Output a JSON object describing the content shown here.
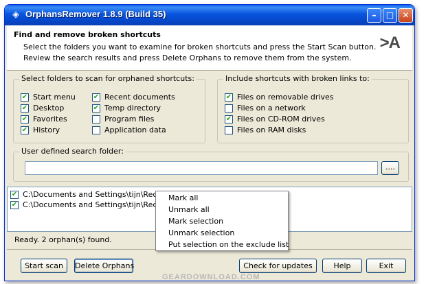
{
  "window": {
    "title": "OrphansRemover 1.8.9 (Build 35)",
    "controls": {
      "minimize": "–",
      "maximize": "□",
      "close": "✕"
    }
  },
  "header": {
    "title": "Find and remove broken shortcuts",
    "line1": "Select the folders you want to examine for broken shortcuts and press the Start Scan button.",
    "line2": "Review the search results and press Delete Orphans to remove them from the system.",
    "logo": ">A"
  },
  "folders_group": {
    "label": "Select folders to scan for orphaned shortcuts:",
    "items": [
      {
        "label": "Start menu",
        "checked": true
      },
      {
        "label": "Desktop",
        "checked": true
      },
      {
        "label": "Favorites",
        "checked": true
      },
      {
        "label": "History",
        "checked": true
      },
      {
        "label": "Recent documents",
        "checked": true
      },
      {
        "label": "Temp directory",
        "checked": true
      },
      {
        "label": "Program files",
        "checked": false
      },
      {
        "label": "Application data",
        "checked": false
      }
    ]
  },
  "links_group": {
    "label": "Include shortcuts with broken links to:",
    "items": [
      {
        "label": "Files on removable drives",
        "checked": true
      },
      {
        "label": "Files on a network",
        "checked": false
      },
      {
        "label": "Files on CD-ROM drives",
        "checked": true
      },
      {
        "label": "Files on RAM disks",
        "checked": false
      }
    ]
  },
  "search_folder": {
    "label": "User defined search folder:",
    "value": "",
    "browse_label": "...."
  },
  "results": [
    {
      "text": "C:\\Documents and Settings\\tijn\\Recent\\",
      "checked": true
    },
    {
      "text": "C:\\Documents and Settings\\tijn\\Recent\\",
      "checked": true
    }
  ],
  "status": "Ready. 2 orphan(s) found.",
  "buttons": {
    "start_scan": "Start scan",
    "delete_orphans": "Delete Orphans",
    "check_updates": "Check for updates",
    "help": "Help",
    "exit": "Exit"
  },
  "context_menu": {
    "items": [
      "Mark all",
      "Unmark all",
      "Mark selection",
      "Unmark selection",
      "Put selection on the exclude list"
    ]
  },
  "watermark": "GEARDOWNLOAD.COM",
  "colors": {
    "title_bar": "#0855dd",
    "window_bg": "#ece9d8",
    "check": "#21a121"
  }
}
